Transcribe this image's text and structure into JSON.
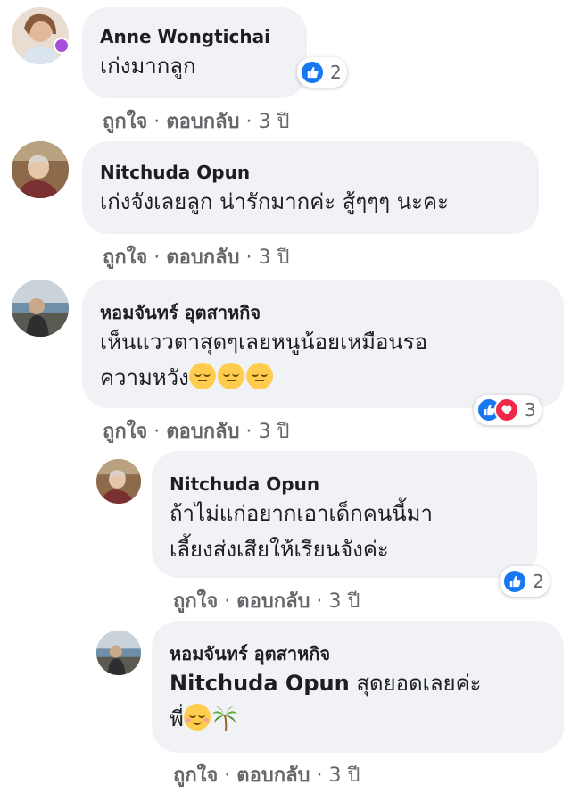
{
  "colors": {
    "bubble": "#f0f2f5",
    "like_blue": "#1877f2",
    "love_red": "#f02849",
    "meta_gray": "#65676b"
  },
  "actions": {
    "like": "ถูกใจ",
    "reply": "ตอบกลับ",
    "sep": "·"
  },
  "comments": [
    {
      "author": "Anne Wongtichai",
      "text": [
        "เก่งมากลูก"
      ],
      "reactions": {
        "types": [
          "like-icon"
        ],
        "count": "2"
      },
      "time": "3 ปี"
    },
    {
      "author": "Nitchuda Opun",
      "text": [
        "เก่งจังเลยลูก น่ารักมากค่ะ สู้ๆๆๆ นะคะ"
      ],
      "time": "3 ปี"
    },
    {
      "author": "หอมจันทร์ อุตสาหกิจ",
      "text": [
        "เห็นแววตาสุดๆเลยหนูน้อยเหมือนรอ",
        "ความหวัง"
      ],
      "emoji": [
        "pensive-face-icon",
        "pensive-face-icon",
        "pensive-face-icon"
      ],
      "reactions": {
        "types": [
          "like-icon",
          "love-icon"
        ],
        "count": "3"
      },
      "time": "3 ปี"
    },
    {
      "author": "Nitchuda Opun",
      "text": [
        "ถ้าไม่แก่อยากเอาเด็กคนนี้มา",
        "เลี้ยงส่งเสียให้เรียนจังค่ะ"
      ],
      "reactions": {
        "types": [
          "like-icon"
        ],
        "count": "2"
      },
      "time": "3 ปี"
    },
    {
      "author": "หอมจันทร์ อุตสาหกิจ",
      "mention": "Nitchuda Opun",
      "text": [
        "สุดยอดเลยค่ะ",
        "พี่"
      ],
      "emoji": [
        "relieved-face-icon",
        "palm-tree-icon"
      ],
      "time": "3 ปี"
    }
  ]
}
